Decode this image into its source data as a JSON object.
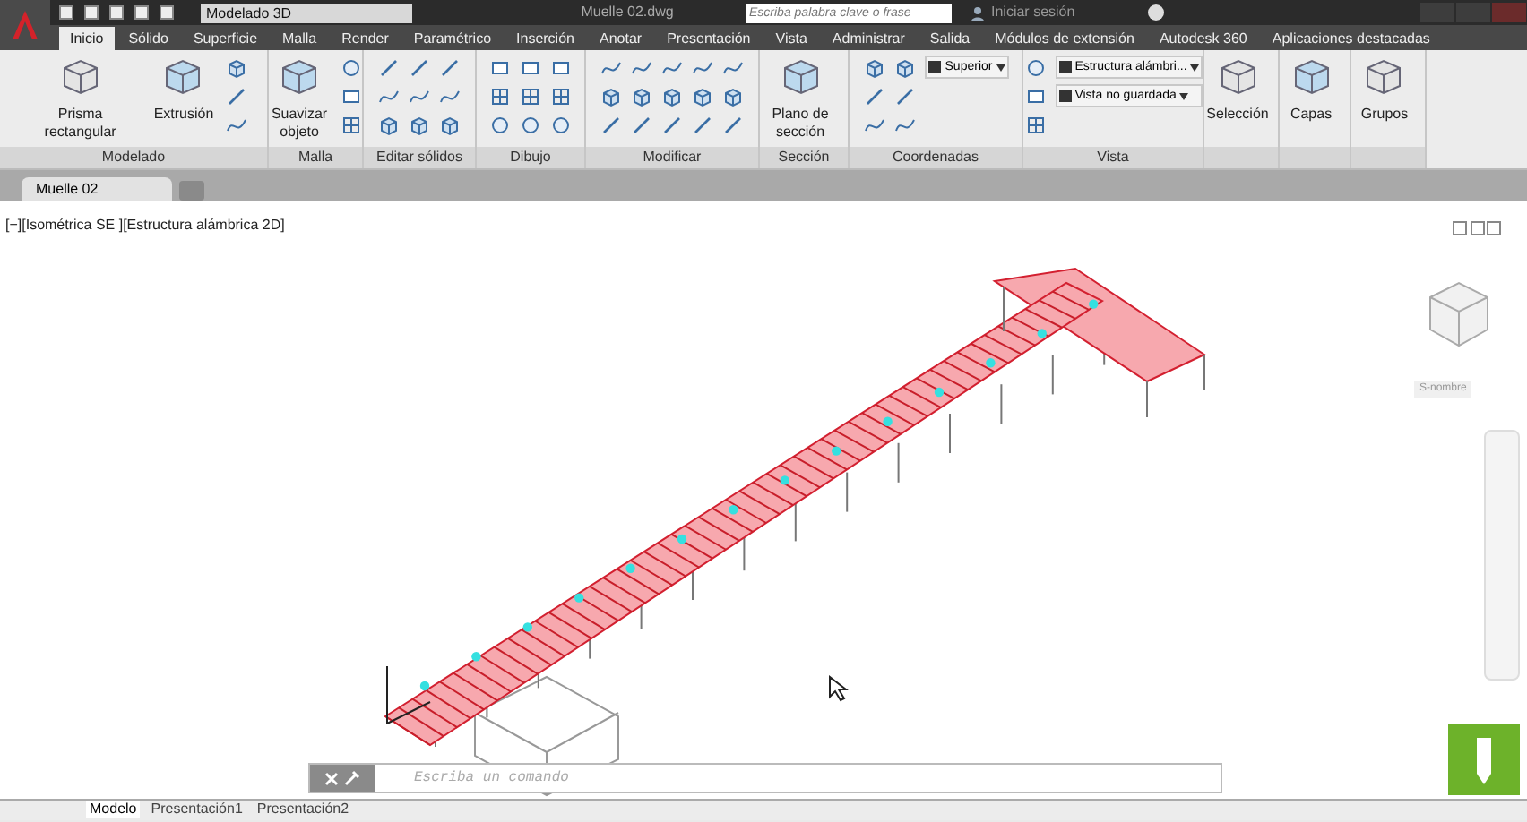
{
  "title_bar": {
    "workspace": "Modelado 3D",
    "file_name": "Muelle 02.dwg",
    "search_placeholder": "Escriba palabra clave o frase",
    "sign_in": "Iniciar sesión"
  },
  "ribbon_tabs": [
    {
      "label": "Inicio",
      "selected": true
    },
    {
      "label": "Sólido",
      "selected": false
    },
    {
      "label": "Superficie",
      "selected": false
    },
    {
      "label": "Malla",
      "selected": false
    },
    {
      "label": "Render",
      "selected": false
    },
    {
      "label": "Paramétrico",
      "selected": false
    },
    {
      "label": "Inserción",
      "selected": false
    },
    {
      "label": "Anotar",
      "selected": false
    },
    {
      "label": "Presentación",
      "selected": false
    },
    {
      "label": "Vista",
      "selected": false
    },
    {
      "label": "Administrar",
      "selected": false
    },
    {
      "label": "Salida",
      "selected": false
    },
    {
      "label": "Módulos de extensión",
      "selected": false
    },
    {
      "label": "Autodesk 360",
      "selected": false
    },
    {
      "label": "Aplicaciones destacadas",
      "selected": false
    }
  ],
  "panels": [
    {
      "label": "Modelado",
      "buttons": [
        "Prisma rectangular",
        "Extrusión"
      ]
    },
    {
      "label": "Malla",
      "buttons": [
        "Suavizar objeto"
      ]
    },
    {
      "label": "Editar sólidos"
    },
    {
      "label": "Dibujo"
    },
    {
      "label": "Modificar"
    },
    {
      "label": "Sección",
      "buttons": [
        "Plano de sección"
      ]
    },
    {
      "label": "Coordenadas",
      "dropdowns": [
        "Superior"
      ]
    },
    {
      "label": "Vista",
      "dropdowns": [
        "Estructura alámbri...",
        "Vista no guardada"
      ]
    },
    {
      "buttons": [
        "Selección"
      ]
    },
    {
      "buttons": [
        "Capas"
      ]
    },
    {
      "buttons": [
        "Grupos"
      ]
    }
  ],
  "document_tabs": [
    {
      "label": "Muelle 02",
      "selected": true
    }
  ],
  "viewport": {
    "label": "[−][Isométrica SE ][Estructura alámbrica 2D]",
    "ucs_label": "S-nombre",
    "command_placeholder": "Escriba un comando"
  },
  "layout_tabs": [
    {
      "label": "Modelo",
      "selected": true
    },
    {
      "label": "Presentación1",
      "selected": false
    },
    {
      "label": "Presentación2",
      "selected": false
    }
  ]
}
